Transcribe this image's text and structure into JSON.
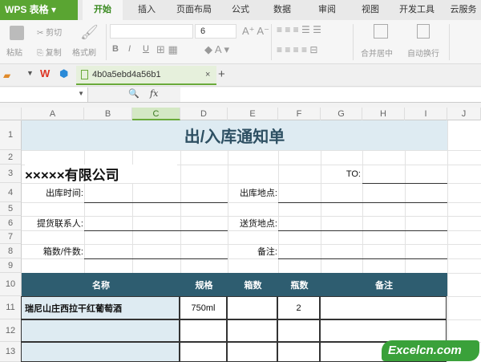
{
  "app": {
    "name": "WPS 表格"
  },
  "menu_tabs": [
    "开始",
    "插入",
    "页面布局",
    "公式",
    "数据",
    "审阅",
    "视图",
    "开发工具",
    "云服务"
  ],
  "ribbon": {
    "paste": "粘贴",
    "cut": "剪切",
    "copy": "复制",
    "format_painter": "格式刷",
    "font_size": "6",
    "bold": "B",
    "italic": "I",
    "underline": "U",
    "merge_center": "合并居中",
    "wrap_text": "自动换行"
  },
  "doc_tab": {
    "name": "4b0a5ebd4a56b1",
    "close": "×",
    "new": "+"
  },
  "formula_bar": {
    "fx": "fx",
    "value": ""
  },
  "columns": [
    "A",
    "B",
    "C",
    "D",
    "E",
    "F",
    "G",
    "H",
    "I",
    "J"
  ],
  "rows": [
    "1",
    "2",
    "3",
    "4",
    "5",
    "6",
    "7",
    "8",
    "9",
    "10",
    "11",
    "12",
    "13"
  ],
  "sheet": {
    "title": "出/入库通知单",
    "company": "×××××有限公司",
    "to_label": "TO:",
    "out_time": "出库时间:",
    "out_location": "出库地点:",
    "pickup_contact": "提货联系人:",
    "delivery_location": "送货地点:",
    "box_count": "箱数/件数:",
    "remark": "备注:",
    "table_headers": [
      "名称",
      "规格",
      "箱数",
      "瓶数",
      "备注"
    ],
    "table_rows": [
      [
        "瑞尼山庄西拉干红葡萄酒",
        "750ml",
        "",
        "2",
        ""
      ],
      [
        "",
        "",
        "",
        "",
        ""
      ],
      [
        "",
        "",
        "",
        "",
        ""
      ]
    ]
  },
  "watermark": "Excelcn.com",
  "colors": {
    "header_fill": "#2e5d70",
    "title_fill": "#deebf2",
    "name_fill": "#deebf2",
    "accent": "#5aa532"
  }
}
